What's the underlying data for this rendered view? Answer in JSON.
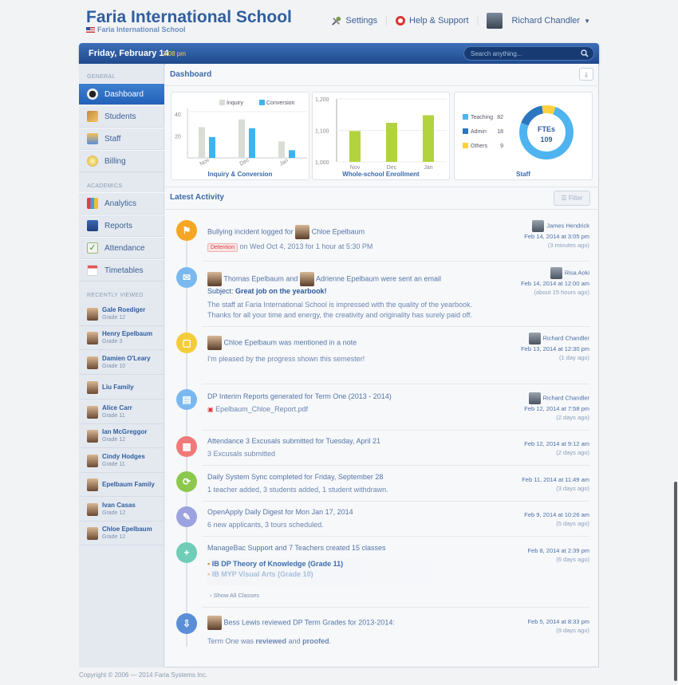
{
  "header": {
    "school_name": "Faria International School",
    "school_sub": "Faria International School",
    "settings": "Settings",
    "help": "Help & Support",
    "user": "Richard Chandler"
  },
  "bar": {
    "date": "Friday, February 14",
    "time": "3:08 pm",
    "search_placeholder": "Search anything..."
  },
  "sidebar": {
    "general_label": "GENERAL",
    "general": [
      "Dashboard",
      "Students",
      "Staff",
      "Billing"
    ],
    "academics_label": "ACADEMICS",
    "academics": [
      "Analytics",
      "Reports",
      "Attendance",
      "Timetables"
    ],
    "recent_label": "RECENTLY VIEWED",
    "recent": [
      {
        "name": "Gale Roediger",
        "grade": "Grade 12"
      },
      {
        "name": "Henry Epelbaum",
        "grade": "Grade 3"
      },
      {
        "name": "Damien O'Leary",
        "grade": "Grade 10"
      },
      {
        "name": "Liu Family",
        "grade": ""
      },
      {
        "name": "Alice Carr",
        "grade": "Grade 11"
      },
      {
        "name": "Ian McGreggor",
        "grade": "Grade 12"
      },
      {
        "name": "Cindy Hodges",
        "grade": "Grade 11"
      },
      {
        "name": "Epelbaum Family",
        "grade": ""
      },
      {
        "name": "Ivan Casas",
        "grade": "Grade 12"
      },
      {
        "name": "Chloe Epelbaum",
        "grade": "Grade 12"
      }
    ]
  },
  "main": {
    "title": "Dashboard",
    "activity_title": "Latest Activity",
    "filter": "Filter"
  },
  "chart_data": [
    {
      "type": "bar",
      "title": "Inquiry & Conversion",
      "categories": [
        "Nov",
        "Dec",
        "Jan"
      ],
      "series": [
        {
          "name": "Inquiry",
          "values": [
            28,
            35,
            15
          ]
        },
        {
          "name": "Conversion",
          "values": [
            19,
            27,
            7
          ]
        }
      ],
      "yticks": [
        "20",
        "40"
      ],
      "ylim": [
        0,
        45
      ],
      "colors": [
        "#d8ddd6",
        "#3db4f0"
      ]
    },
    {
      "type": "bar",
      "title": "Whole-school Enrollment",
      "categories": [
        "Nov",
        "Dec",
        "Jan"
      ],
      "values": [
        1098,
        1124,
        1148
      ],
      "yticks": [
        "1,000",
        "1,100",
        "1,200"
      ],
      "ylim": [
        1000,
        1200
      ],
      "color": "#b2d33d"
    },
    {
      "type": "pie",
      "title": "Staff",
      "center_label": "FTEs",
      "center_value": "109",
      "slices": [
        {
          "name": "Teaching",
          "value": 82,
          "color": "#4fb3f0"
        },
        {
          "name": "Admin",
          "value": 18,
          "color": "#2a76c0"
        },
        {
          "name": "Others",
          "value": 9,
          "color": "#ffd13d"
        }
      ]
    }
  ],
  "events": [
    {
      "color": "#f5a623",
      "icon": "⚑",
      "t1": "Bullying",
      "t2": " incident logged for ",
      "who": "Chloe Epelbaum",
      "sub_badge": "Detention",
      "sub": "on Wed Oct 4, 2013 for 1 hour at 5:30 PM",
      "author": "James Hendrick",
      "time": "Feb 14, 2014 at 3:05 pm",
      "ago": "(3 minutes ago)"
    },
    {
      "color": "#7ab9ef",
      "icon": "✉",
      "p1": "Thomas Epelbaum",
      "and": " and ",
      "p2": "Adrienne Epelbaum",
      "t2": " were sent an email",
      "subject_label": "Subject:",
      "subject": "Great job on the yearbook!",
      "body1": "The staff at Faria International School is impressed with the quality of the yearbook.",
      "body2": "Thanks for all your time and energy, the creativity and originality has surely paid off.",
      "author": "Risa Aoki",
      "time": "Feb 14, 2014 at 12:00 am",
      "ago": "(about 15 hours ago)"
    },
    {
      "color": "#f4cc3a",
      "icon": "▢",
      "who": "Chloe Epelbaum",
      "t2": " was mentioned in a note",
      "sub": "I'm pleased by the progress shown this semester!",
      "author": "Richard Chandler",
      "time": "Feb 13, 2014 at 12:30 pm",
      "ago": "(1 day ago)"
    },
    {
      "color": "#7ab9ef",
      "icon": "▤",
      "t1": "DP Interim Reports",
      "t2": " generated for ",
      "t3": "Term One (2013 - 2014)",
      "file": "Epelbaum_Chloe_Report.pdf",
      "author": "Richard Chandler",
      "time": "Feb 12, 2014 at 7:58 pm",
      "ago": "(2 days ago)"
    },
    {
      "color": "#f07a7a",
      "icon": "▦",
      "t1": "Attendance 3 Excusals",
      "t2": " submitted for ",
      "t3": "Tuesday, April 21",
      "sub": "3 Excusals submitted",
      "time": "Feb 12, 2014 at 9:12 am",
      "ago": "(2 days ago)"
    },
    {
      "color": "#8cc84b",
      "icon": "⟳",
      "t1": "Daily System Sync",
      "t2": " completed for ",
      "t3": "Friday, September 28",
      "sub": "1 teacher added, 3 students added, 1 student withdrawn.",
      "time": "Feb 11, 2014 at 11:49 am",
      "ago": "(3 days ago)"
    },
    {
      "color": "#9da3e0",
      "icon": "✎",
      "t1": "OpenApply Daily Digest",
      "t2": " for ",
      "t3": "Mon Jan 17, 2014",
      "sub": "6 new applicants, 3 tours scheduled.",
      "time": "Feb 9, 2014 at 10:26 am",
      "ago": "(5 days ago)"
    },
    {
      "color": "#6fcdb8",
      "icon": "+",
      "t1": "ManageBac Support",
      "t2": " and ",
      "t3": "7 Teachers",
      "t4": " created ",
      "t5": "15 classes",
      "class1": "IB DP Theory of Knowledge (Grade 11)",
      "class2": "IB MYP Visual Arts (Grade 10)",
      "show_all": "Show All Classes",
      "time": "Feb 8, 2014 at 2:39 pm",
      "ago": "(6 days ago)"
    },
    {
      "color": "#5a8fd8",
      "icon": "⇩",
      "who": "Bess Lewis",
      "t2": " reviewed ",
      "t3": "DP Term Grades",
      "t4": " for 2013-2014:",
      "sub1": "Term One was ",
      "sub2": "reviewed",
      "sub3": " and ",
      "sub4": "proofed",
      "sub5": ".",
      "time": "Feb 5, 2014 at 8:33 pm",
      "ago": "(9 days ago)"
    }
  ],
  "footer": "Copyright © 2006 — 2014 Faria Systems Inc."
}
